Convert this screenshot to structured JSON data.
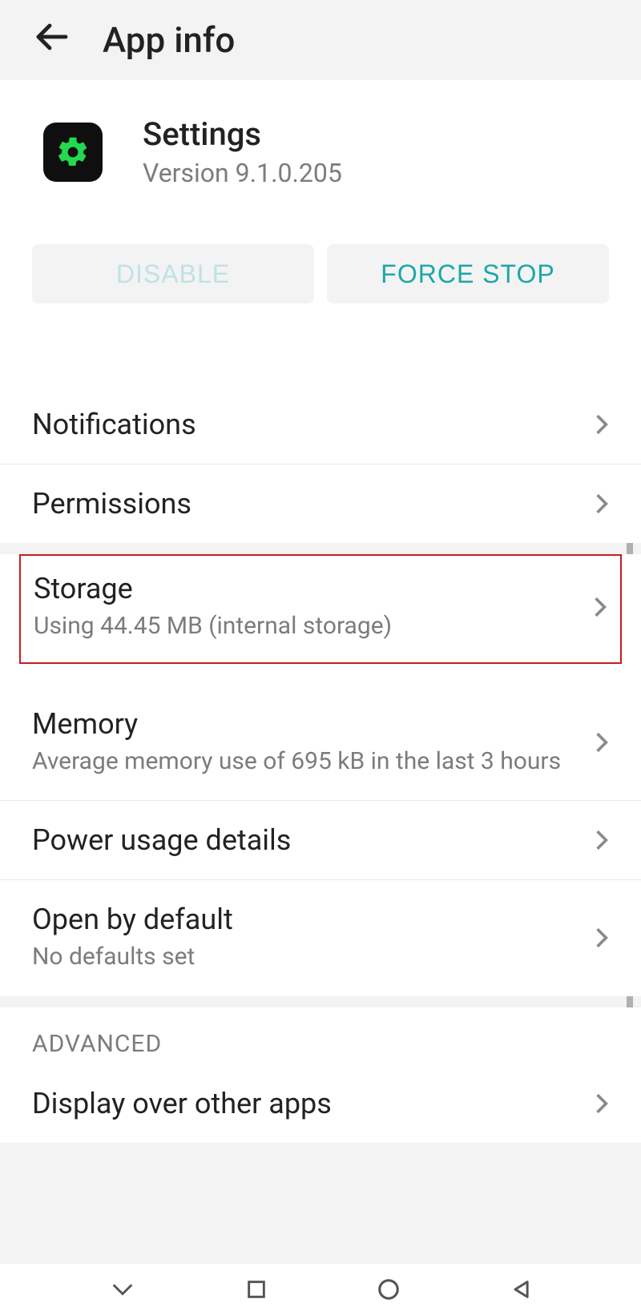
{
  "header": {
    "title": "App info"
  },
  "app": {
    "name": "Settings",
    "version_label": "Version 9.1.0.205"
  },
  "buttons": {
    "disable": "DISABLE",
    "force_stop": "FORCE STOP"
  },
  "items": {
    "notifications": {
      "title": "Notifications"
    },
    "permissions": {
      "title": "Permissions"
    },
    "storage": {
      "title": "Storage",
      "sub": "Using 44.45 MB (internal storage)"
    },
    "memory": {
      "title": "Memory",
      "sub": "Average memory use of 695 kB in the last 3 hours"
    },
    "power": {
      "title": "Power usage details"
    },
    "open_default": {
      "title": "Open by default",
      "sub": "No defaults set"
    },
    "display_over": {
      "title": "Display over other apps"
    }
  },
  "sections": {
    "advanced": "ADVANCED"
  }
}
